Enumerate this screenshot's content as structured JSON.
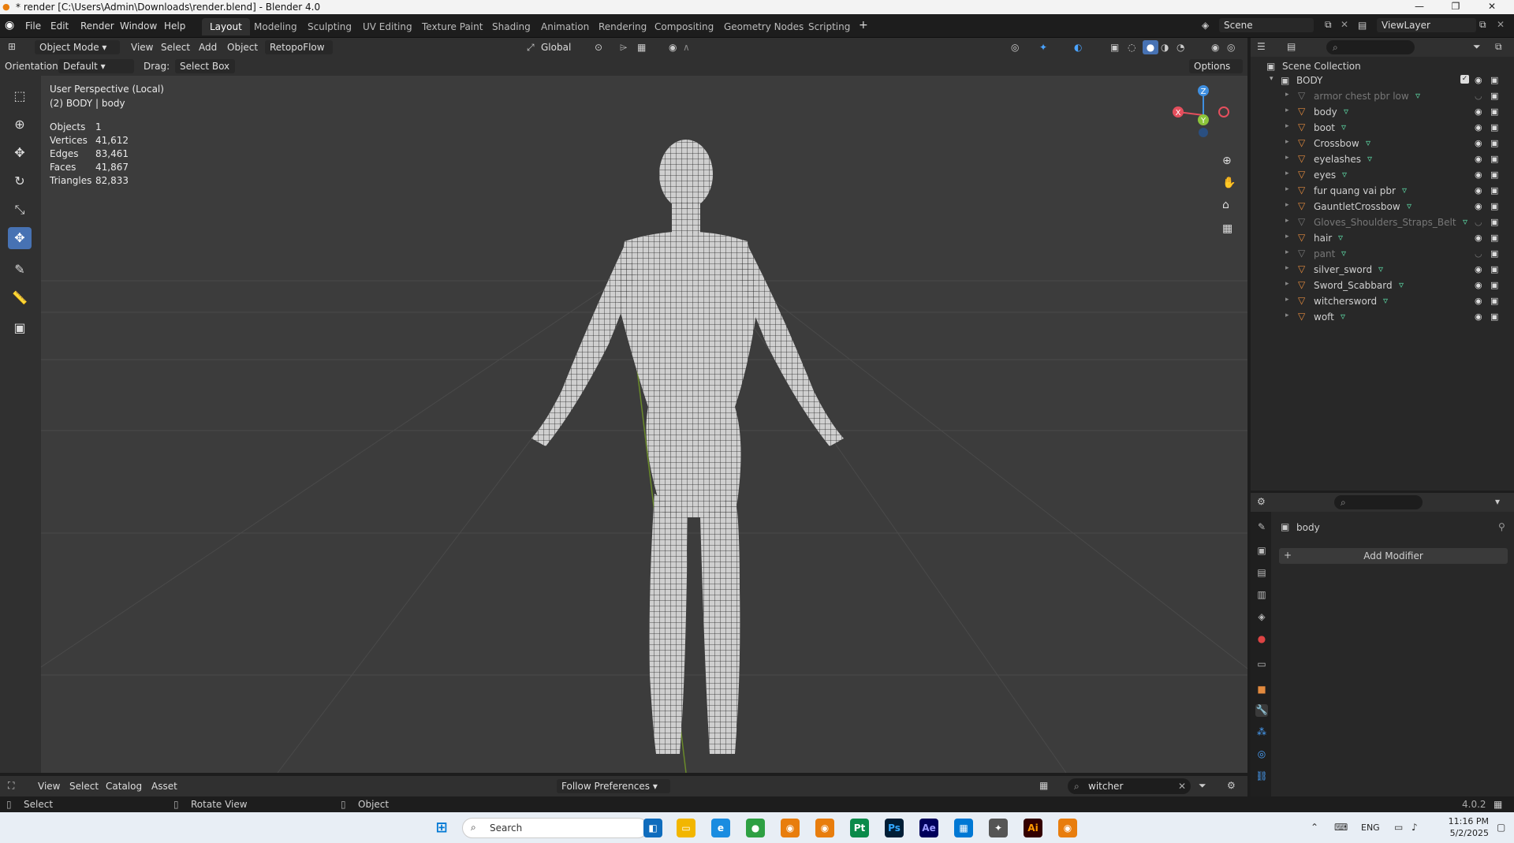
{
  "window": {
    "title": "* render [C:\\Users\\Admin\\Downloads\\render.blend] - Blender 4.0"
  },
  "menu": [
    "File",
    "Edit",
    "Render",
    "Window",
    "Help"
  ],
  "workspaces": [
    "Layout",
    "Modeling",
    "Sculpting",
    "UV Editing",
    "Texture Paint",
    "Shading",
    "Animation",
    "Rendering",
    "Compositing",
    "Geometry Nodes",
    "Scripting"
  ],
  "active_workspace": "Layout",
  "scene": {
    "name": "Scene",
    "view_layer": "ViewLayer"
  },
  "viewport_header": {
    "mode": "Object Mode",
    "menus": [
      "View",
      "Select",
      "Add",
      "Object"
    ],
    "addon": "RetopoFlow",
    "transform_orientation": "Global",
    "orientation_label": "Orientation:",
    "orientation_value": "Default",
    "drag_label": "Drag:",
    "drag_value": "Select Box",
    "options": "Options"
  },
  "overlay": {
    "view": "User Perspective (Local)",
    "object": "(2) BODY | body",
    "stats": [
      {
        "label": "Objects",
        "value": "1"
      },
      {
        "label": "Vertices",
        "value": "41,612"
      },
      {
        "label": "Edges",
        "value": "83,461"
      },
      {
        "label": "Faces",
        "value": "41,867"
      },
      {
        "label": "Triangles",
        "value": "82,833"
      }
    ]
  },
  "gizmo": {
    "x": "X",
    "y": "Y",
    "z": "Z"
  },
  "outliner": {
    "root": "Scene Collection",
    "collection": "BODY",
    "items": [
      {
        "name": "armor chest pbr low",
        "hidden": true
      },
      {
        "name": "body",
        "hidden": false
      },
      {
        "name": "boot",
        "hidden": false
      },
      {
        "name": "Crossbow",
        "hidden": false
      },
      {
        "name": "eyelashes",
        "hidden": false
      },
      {
        "name": "eyes",
        "hidden": false
      },
      {
        "name": "fur quang vai pbr",
        "hidden": false
      },
      {
        "name": "GauntletCrossbow",
        "hidden": false
      },
      {
        "name": "Gloves_Shoulders_Straps_Belt",
        "hidden": true
      },
      {
        "name": "hair",
        "hidden": false
      },
      {
        "name": "pant",
        "hidden": true
      },
      {
        "name": "silver_sword",
        "hidden": false
      },
      {
        "name": "Sword_Scabbard",
        "hidden": false
      },
      {
        "name": "witchersword",
        "hidden": false
      },
      {
        "name": "woft",
        "hidden": false
      }
    ]
  },
  "properties": {
    "object": "body",
    "add_modifier": "Add Modifier"
  },
  "asset_bar": {
    "menus": [
      "View",
      "Select",
      "Catalog",
      "Asset"
    ],
    "import": "Follow Preferences",
    "search": "witcher"
  },
  "status": {
    "left": "Select",
    "middle": "Rotate View",
    "right": "Object",
    "version": "4.0.2"
  },
  "taskbar": {
    "search": "Search",
    "lang": "ENG",
    "time": "11:16 PM",
    "date": "5/2/2025"
  },
  "colors": {
    "accent": "#4772b3",
    "viewport": "#3c3c3c",
    "panel": "#303030",
    "axis_x": "#e54f5d",
    "axis_y": "#8cc43a",
    "axis_z": "#3f8fe0"
  }
}
